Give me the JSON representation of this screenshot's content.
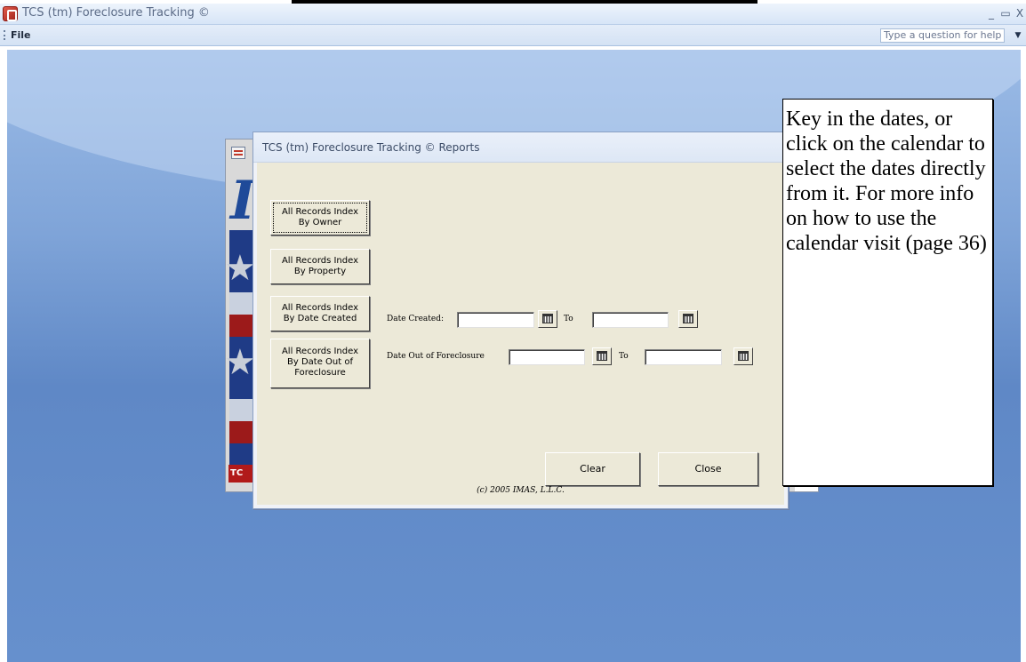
{
  "app": {
    "title": "TCS (tm) Foreclosure Tracking ©",
    "minimize_glyph": "_",
    "restore_glyph": "▭",
    "close_glyph": "X"
  },
  "menu": {
    "file_label": "File",
    "help_placeholder": "Type a question for help"
  },
  "dialog": {
    "title": "TCS (tm) Foreclosure Tracking ©  Reports",
    "buttons": {
      "by_owner": [
        "All Records Index",
        "By Owner"
      ],
      "by_property": [
        "All Records Index",
        "By Property"
      ],
      "by_date_created": [
        "All Records Index",
        "By Date Created"
      ],
      "by_date_out": [
        "All Records Index",
        "By Date Out of",
        "Foreclosure"
      ]
    },
    "date_created_label": "Date Created:",
    "date_out_label": "Date Out of Foreclosure",
    "to_label": "To",
    "date_created_from": "",
    "date_created_to": "",
    "date_out_from": "",
    "date_out_to": "",
    "clear_label": "Clear",
    "close_label": "Close",
    "copyright": "(c) 2005 IMAS, L.L.C."
  },
  "splash": {
    "logo_letter": "I",
    "banner_text": "TC"
  },
  "callout": {
    "text": "Key in the dates, or click on the calendar to select the dates directly from it. For more info on how to use the calendar visit (page 36)"
  },
  "colors": {
    "workspace_top": "#9bbbe6",
    "workspace_bottom": "#6690cd",
    "dialog_body": "#ece9d8"
  }
}
